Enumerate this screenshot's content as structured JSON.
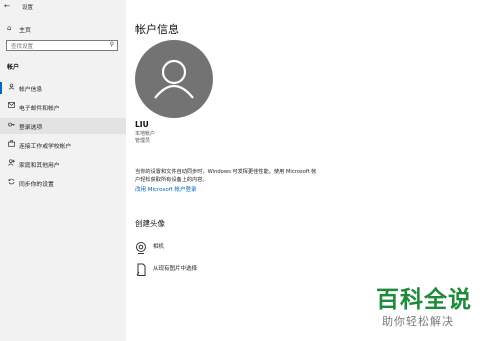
{
  "window": {
    "title": "设置"
  },
  "sidebar": {
    "home_label": "主页",
    "search_placeholder": "查找设置",
    "section": "帐户",
    "items": [
      {
        "label": "帐户信息",
        "icon": "person-card-icon",
        "selected": true
      },
      {
        "label": "电子邮件和帐户",
        "icon": "mail-icon"
      },
      {
        "label": "登录选项",
        "icon": "key-icon",
        "hover": true
      },
      {
        "label": "连接工作或学校帐户",
        "icon": "briefcase-icon"
      },
      {
        "label": "家庭和其他用户",
        "icon": "person-add-icon"
      },
      {
        "label": "同步你的设置",
        "icon": "sync-icon"
      }
    ]
  },
  "main": {
    "title": "帐户信息",
    "user": {
      "name": "LIU",
      "type": "本地帐户",
      "role": "管理员"
    },
    "description": "当你的设置和文件自动同步时，Windows 可发挥更佳性能。使用 Microsoft 帐户轻松获取所有设备上的内容。",
    "ms_link": "改用 Microsoft 帐户登录",
    "create_avatar": {
      "title": "创建头像",
      "options": [
        {
          "label": "相机",
          "icon": "camera-icon"
        },
        {
          "label": "从现有图片中选择",
          "icon": "image-browse-icon"
        }
      ]
    }
  },
  "watermark": {
    "main": "百科全说",
    "sub": "助你轻松解决"
  },
  "colors": {
    "accent": "#0067c0",
    "sidebar_bg": "#f2f2f2",
    "avatar_bg": "#737373",
    "watermark": "#1e8b3a"
  }
}
